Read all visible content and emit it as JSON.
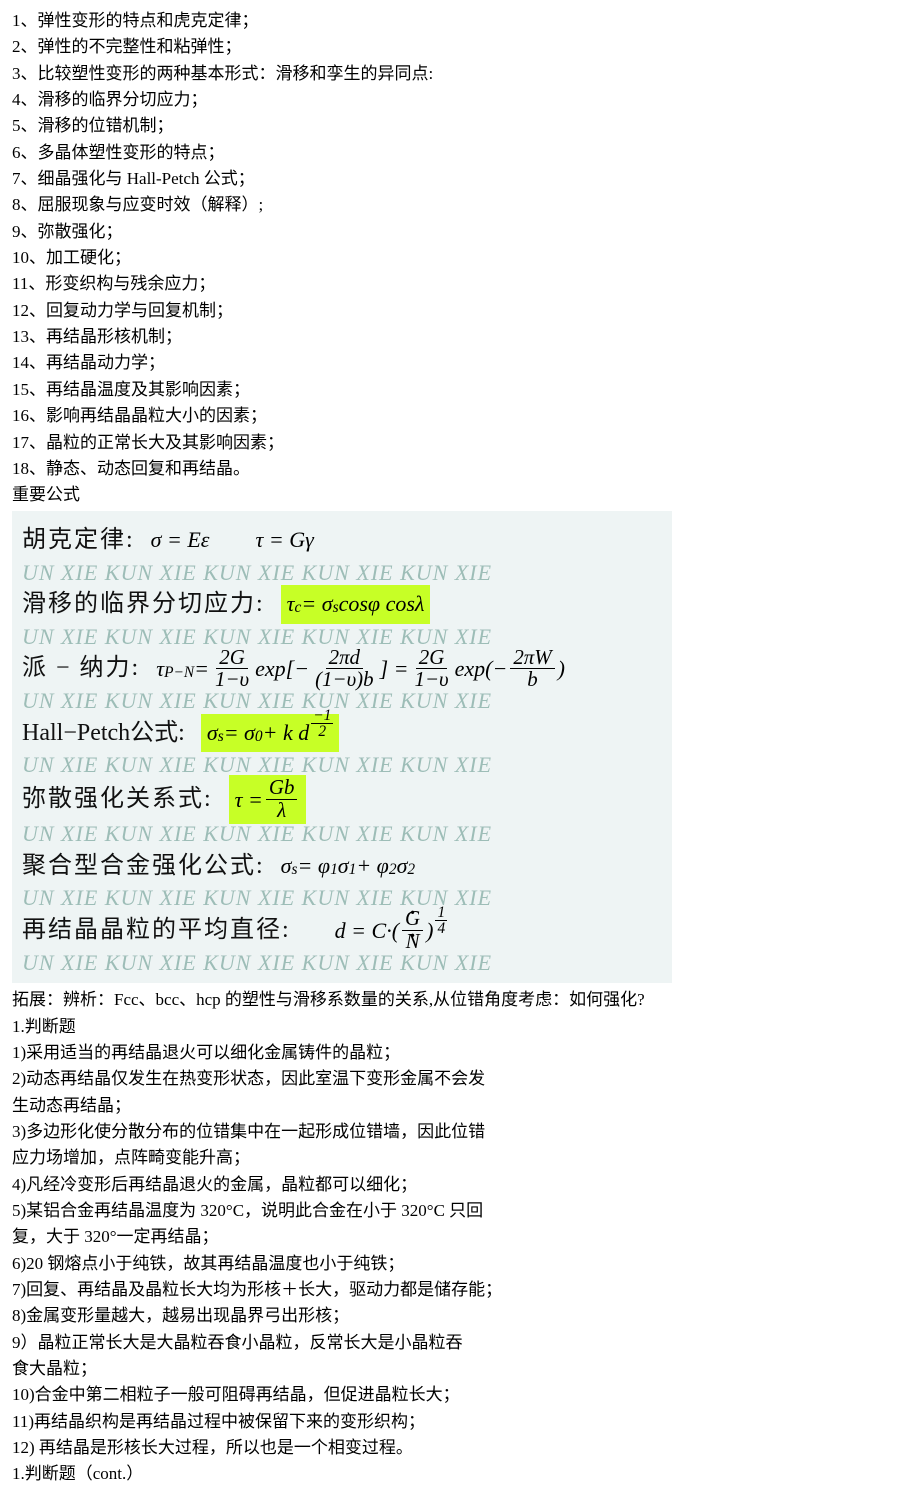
{
  "topics": [
    "1、弹性变形的特点和虎克定律；",
    "2、弹性的不完整性和粘弹性；",
    "3、比较塑性变形的两种基本形式：滑移和孪生的异同点:",
    "4、滑移的临界分切应力；",
    "5、滑移的位错机制；",
    "6、多晶体塑性变形的特点；",
    "7、细晶强化与 Hall-Petch 公式；",
    "8、屈服现象与应变时效（解释）;",
    "9、弥散强化；",
    "10、加工硬化；",
    "11、形变织构与残余应力；",
    "12、回复动力学与回复机制；",
    "13、再结晶形核机制；",
    "14、再结晶动力学；",
    "15、再结晶温度及其影响因素；",
    "16、影响再结晶晶粒大小的因素；",
    "17、晶粒的正常长大及其影响因素；",
    "18、静态、动态回复和再结晶。"
  ],
  "section_formula_title": "重要公式",
  "watermark": "UN XIE KUN XIE KUN XIE KUN XIE KUN XIE",
  "formulas": {
    "hooke": {
      "label": "胡克定律:",
      "eq1": "σ = Eε",
      "eq2": "τ = Gγ"
    },
    "crss": {
      "label": "滑移的临界分切应力:",
      "eq": "τc = σs cosφ cosλ"
    },
    "pn": {
      "label": "派 − 纳力:"
    },
    "hall": {
      "label": "Hall−Petch公式:",
      "eq": "σs = σ0 + k d^(−1/2)"
    },
    "disp": {
      "label": "弥散强化关系式:",
      "eq": "τ = Gb / λ"
    },
    "alloy": {
      "label": "聚合型合金强化公式:",
      "eq": "σs = φ1σ1 + φ2σ2"
    },
    "grain": {
      "label": "再结晶晶粒的平均直径:",
      "eq": "d = C·(Ġ / Ṅ)^(1/4)"
    }
  },
  "extension": "拓展：辨析：Fcc、bcc、hcp 的塑性与滑移系数量的关系,从位错角度考虑：如何强化?",
  "judgement_title": "1.判断题",
  "questions": [
    "1)采用适当的再结晶退火可以细化金属铸件的晶粒；",
    "2)动态再结晶仅发生在热变形状态，因此室温下变形金属不会发",
    "生动态再结晶；",
    "3)多边形化使分散分布的位错集中在一起形成位错墙，因此位错",
    "应力场增加，点阵畸变能升高；",
    "4)凡经冷变形后再结晶退火的金属，晶粒都可以细化；",
    "5)某铝合金再结晶温度为 320°C，说明此合金在小于 320°C 只回",
    "复，大于 320°一定再结晶；",
    "6)20 钢熔点小于纯铁，故其再结晶温度也小于纯铁；",
    "7)回复、再结晶及晶粒长大均为形核＋长大，驱动力都是储存能；",
    "8)金属变形量越大，越易出现晶界弓出形核；",
    "9）晶粒正常长大是大晶粒吞食小晶粒，反常长大是小晶粒吞",
    "食大晶粒；",
    "10)合金中第二相粒子一般可阻碍再结晶，但促进晶粒长大；",
    "11)再结晶织构是再结晶过程中被保留下来的变形织构；",
    "12) 再结晶是形核长大过程，所以也是一个相变过程。"
  ],
  "judgement_cont": "1.判断题（cont.）"
}
